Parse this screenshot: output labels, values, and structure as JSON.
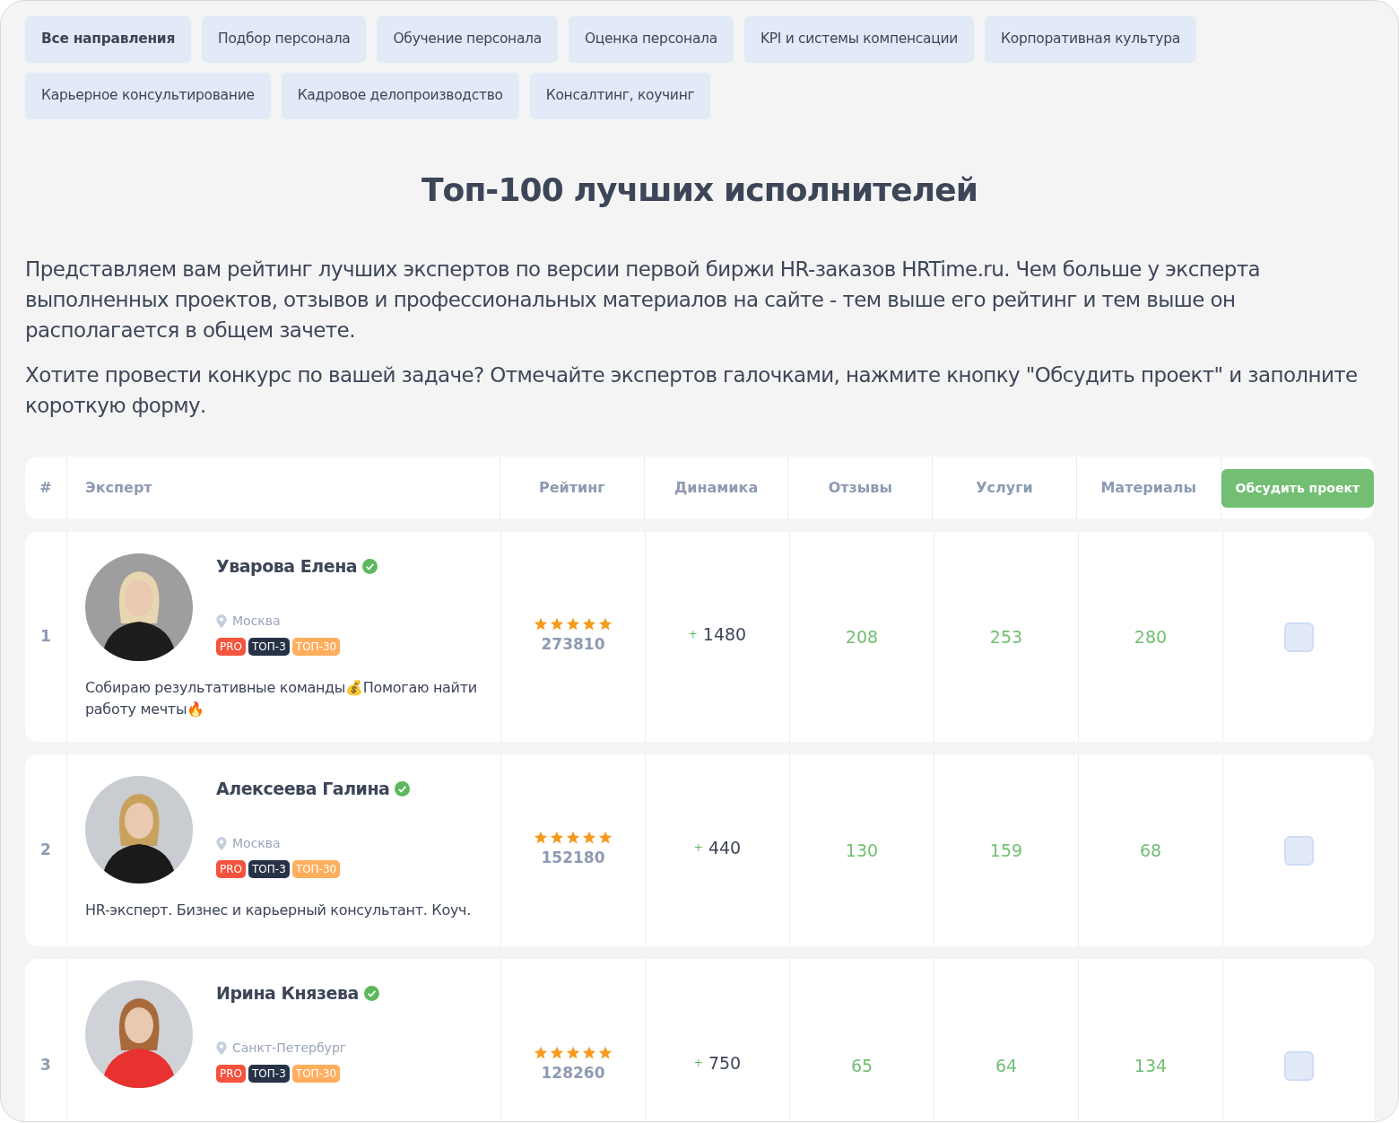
{
  "tabs": [
    {
      "label": "Все направления",
      "selected": true
    },
    {
      "label": "Подбор персонала",
      "selected": false
    },
    {
      "label": "Обучение персонала",
      "selected": false
    },
    {
      "label": "Оценка персонала",
      "selected": false
    },
    {
      "label": "KPI и системы компенсации",
      "selected": false
    },
    {
      "label": "Корпоративная культура",
      "selected": false
    },
    {
      "label": "Карьерное консультирование",
      "selected": false
    },
    {
      "label": "Кадровое делопроизводство",
      "selected": false
    },
    {
      "label": "Консалтинг, коучинг",
      "selected": false
    }
  ],
  "title": "Топ-100 лучших исполнителей",
  "paragraphs": [
    "Представляем вам рейтинг лучших экспертов по версии первой биржи HR-заказов HRTime.ru. Чем больше у эксперта выполненных проектов, отзывов и профессиональных материалов на сайте - тем выше его рейтинг и тем выше он располагается в общем зачете.",
    "Хотите провести конкурс по вашей задаче? Отмечайте экспертов галочками, нажмите кнопку \"Обсудить проект\" и заполните короткую форму."
  ],
  "table": {
    "columns": [
      "#",
      "Эксперт",
      "Рейтинг",
      "Динамика",
      "Отзывы",
      "Услуги",
      "Материалы"
    ],
    "action_button": "Обсудить проект",
    "rows": [
      {
        "rank": "1",
        "name": "Уварова Елена",
        "verified": true,
        "city": "Москва",
        "badges": [
          {
            "label": "PRO",
            "kind": "pro"
          },
          {
            "label": "ТОП-3",
            "kind": "top3"
          },
          {
            "label": "ТОП-30",
            "kind": "top30"
          }
        ],
        "bio": "Собираю результативные команды💰Помогаю найти работу мечты🔥",
        "stars": 5,
        "rating": "273810",
        "dynamics_sign": "+",
        "dynamics": "1480",
        "reviews": "208",
        "services": "253",
        "materials": "280",
        "checked": false
      },
      {
        "rank": "2",
        "name": "Алексеева Галина",
        "verified": true,
        "city": "Москва",
        "badges": [
          {
            "label": "PRO",
            "kind": "pro"
          },
          {
            "label": "ТОП-3",
            "kind": "top3"
          },
          {
            "label": "ТОП-30",
            "kind": "top30"
          }
        ],
        "bio": "HR-эксперт. Бизнес и карьерный консультант. Коуч.",
        "stars": 5,
        "rating": "152180",
        "dynamics_sign": "+",
        "dynamics": "440",
        "reviews": "130",
        "services": "159",
        "materials": "68",
        "checked": false
      },
      {
        "rank": "3",
        "name": "Ирина Князева",
        "verified": true,
        "city": "Санкт-Петербург",
        "badges": [
          {
            "label": "PRO",
            "kind": "pro"
          },
          {
            "label": "ТОП-3",
            "kind": "top3"
          },
          {
            "label": "ТОП-30",
            "kind": "top30"
          }
        ],
        "stars": 5,
        "rating": "128260",
        "dynamics_sign": "+",
        "dynamics": "750",
        "reviews": "65",
        "services": "64",
        "materials": "134",
        "checked": false
      }
    ]
  }
}
